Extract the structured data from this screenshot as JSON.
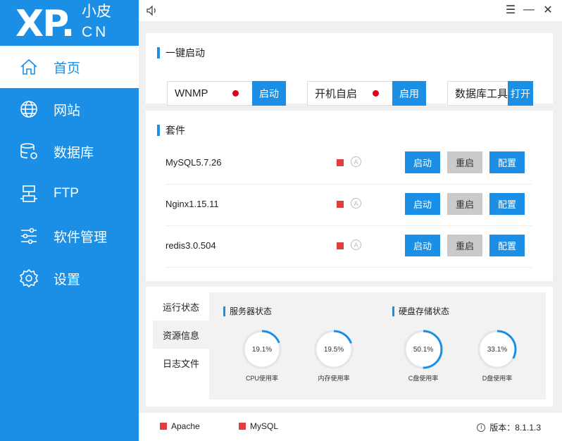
{
  "logo": {
    "main": "XP.",
    "cn_top": "小皮",
    "cn_bottom": "CN"
  },
  "nav": [
    {
      "label": "首页",
      "icon": "home-icon",
      "active": true
    },
    {
      "label": "网站",
      "icon": "globe-icon"
    },
    {
      "label": "数据库",
      "icon": "database-icon"
    },
    {
      "label": "FTP",
      "icon": "ftp-icon"
    },
    {
      "label": "软件管理",
      "icon": "sliders-icon"
    },
    {
      "label": "设置",
      "icon": "gear-icon"
    }
  ],
  "window": {
    "minimize": "—",
    "close": "✕",
    "menu": "☰"
  },
  "quick_start": {
    "title": "一键启动",
    "items": [
      {
        "label": "WNMP",
        "button": "启动",
        "status_color": "#e0001b"
      },
      {
        "label": "开机自启",
        "button": "启用",
        "status_color": "#e0001b"
      },
      {
        "label": "数据库工具",
        "button": "打开"
      }
    ]
  },
  "packages": {
    "title": "套件",
    "auto_badge": "A",
    "buttons": {
      "start": "启动",
      "restart": "重启",
      "config": "配置"
    },
    "rows": [
      {
        "name": "MySQL5.7.26"
      },
      {
        "name": "Nginx1.15.11"
      },
      {
        "name": "redis3.0.504"
      }
    ]
  },
  "status": {
    "tabs": [
      "运行状态",
      "资源信息",
      "日志文件"
    ],
    "active_tab": 1,
    "server_title": "服务器状态",
    "disk_title": "硬盘存储状态",
    "gauges": [
      {
        "value": "19.1%",
        "label": "CPU使用率",
        "fraction": 0.191
      },
      {
        "value": "19.5%",
        "label": "内存使用率",
        "fraction": 0.195
      },
      {
        "value": "50.1%",
        "label": "C盘使用率",
        "fraction": 0.501
      },
      {
        "value": "33.1%",
        "label": "D盘使用率",
        "fraction": 0.331
      }
    ]
  },
  "footer": {
    "services": [
      "Apache",
      "MySQL"
    ],
    "version_label": "版本：8.1.1.3"
  }
}
